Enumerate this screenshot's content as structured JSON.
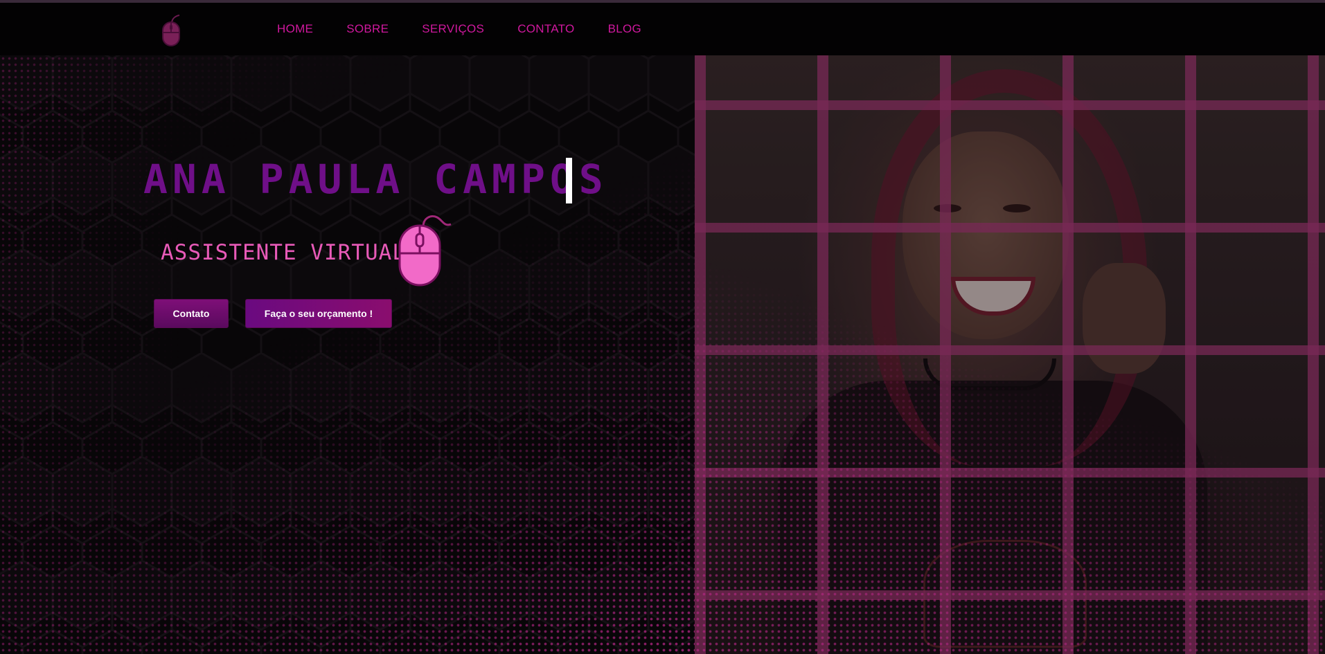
{
  "nav": {
    "logo_icon": "mouse-icon",
    "links": [
      {
        "label": "HOME"
      },
      {
        "label": "SOBRE"
      },
      {
        "label": "SERVIÇOS"
      },
      {
        "label": "CONTATO"
      },
      {
        "label": "BLOG"
      }
    ]
  },
  "hero": {
    "name": "ANA PAULA CAMPOS",
    "subtitle": "ASSISTENTE VIRTUAL",
    "subtitle_icon": "mouse-icon",
    "buttons": {
      "contact_label": "Contato",
      "quote_label": "Faça o seu orçamento !"
    },
    "photo_icon": "portrait-photo"
  },
  "colors": {
    "accent": "#d0189e",
    "name_color": "#6f0f88",
    "subtitle_color": "#e85ab8",
    "background": "#070507",
    "button_bg": "#7e0f78"
  }
}
